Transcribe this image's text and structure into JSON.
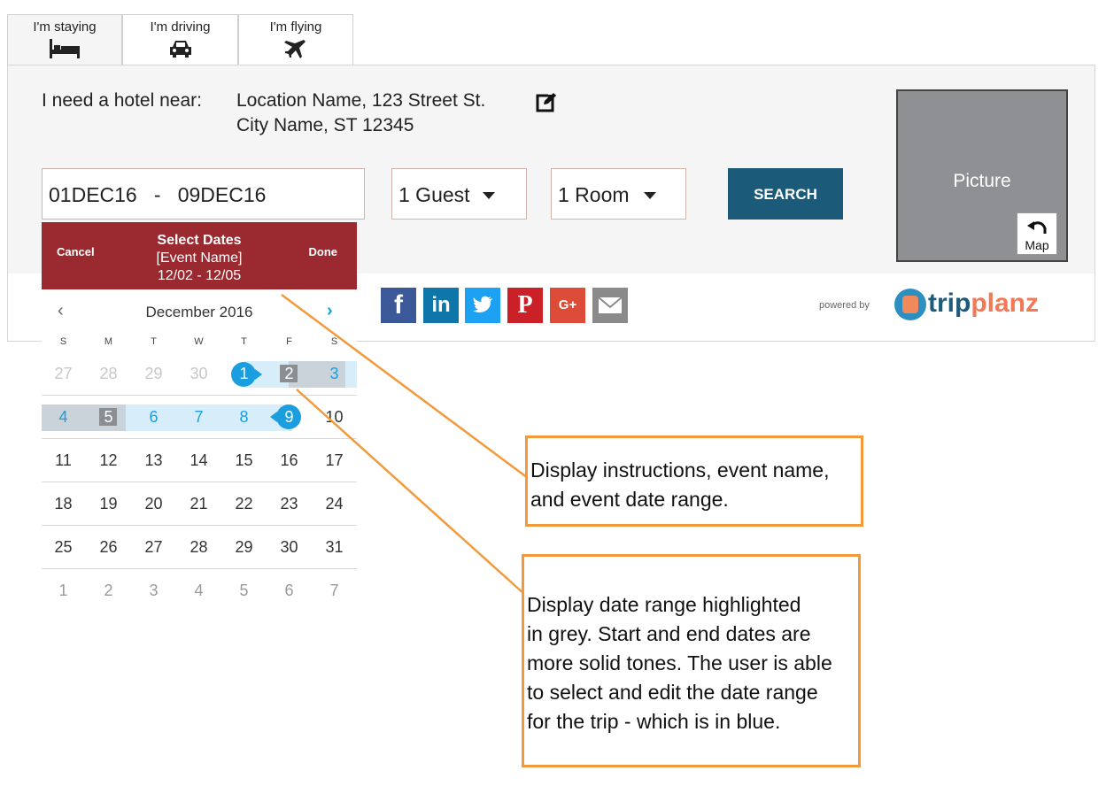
{
  "tabs": [
    {
      "label": "I'm staying",
      "icon": "bed-icon",
      "active": true
    },
    {
      "label": "I'm driving",
      "icon": "car-icon",
      "active": false
    },
    {
      "label": "I'm flying",
      "icon": "plane-icon",
      "active": false
    }
  ],
  "location": {
    "label": "I need a hotel near:",
    "line1": "Location Name, 123 Street St.",
    "line2": "City Name, ST  12345",
    "edit_icon": "edit-icon"
  },
  "search": {
    "dates_value": "01DEC16   -   09DEC16",
    "guests_value": "1 Guest",
    "rooms_value": "1 Room",
    "button_label": "SEARCH"
  },
  "picture": {
    "label": "Picture",
    "map_label": "Map"
  },
  "calendar": {
    "cancel_label": "Cancel",
    "done_label": "Done",
    "title": "Select Dates",
    "event_name": "[Event Name]",
    "event_range": "12/02 - 12/05",
    "month_label": "December 2016",
    "prev_icon": "chevron-left-icon",
    "next_icon": "chevron-right-icon",
    "weekdays": [
      "S",
      "M",
      "T",
      "W",
      "T",
      "F",
      "S"
    ],
    "weeks": [
      [
        "27",
        "28",
        "29",
        "30",
        "1",
        "2",
        "3"
      ],
      [
        "4",
        "5",
        "6",
        "7",
        "8",
        "9",
        "10"
      ],
      [
        "11",
        "12",
        "13",
        "14",
        "15",
        "16",
        "17"
      ],
      [
        "18",
        "19",
        "20",
        "21",
        "22",
        "23",
        "24"
      ],
      [
        "25",
        "26",
        "27",
        "28",
        "29",
        "30",
        "31"
      ],
      [
        "1",
        "2",
        "3",
        "4",
        "5",
        "6",
        "7"
      ]
    ],
    "colors": {
      "header": "#9a2a30",
      "range_blue": "#1a9ee0",
      "event_grey": "#8c8f92"
    }
  },
  "social": {
    "buttons": [
      {
        "label": "f",
        "icon": "facebook-icon",
        "color": "#3b5998"
      },
      {
        "label": "in",
        "icon": "linkedin-icon",
        "color": "#0e76a8"
      },
      {
        "label": "t",
        "icon": "twitter-icon",
        "color": "#1da1f2"
      },
      {
        "label": "P",
        "icon": "pinterest-icon",
        "color": "#cb2027"
      },
      {
        "label": "G+",
        "icon": "google-plus-icon",
        "color": "#dd4b39"
      },
      {
        "label": "",
        "icon": "email-icon",
        "color": "#8a8a8a"
      }
    ],
    "powered_by": "powered by",
    "brand_part1": "trip",
    "brand_part2": "planz"
  },
  "annotations": [
    {
      "lines": [
        "Display instructions, event name,",
        "and event date range."
      ]
    },
    {
      "lines": [
        "Display date range highlighted",
        "in grey. Start and end dates are",
        "more solid tones. The user is able",
        "to select and edit the date range",
        "for the trip - which is in blue."
      ]
    }
  ],
  "annotation_color": "#f29a3b"
}
